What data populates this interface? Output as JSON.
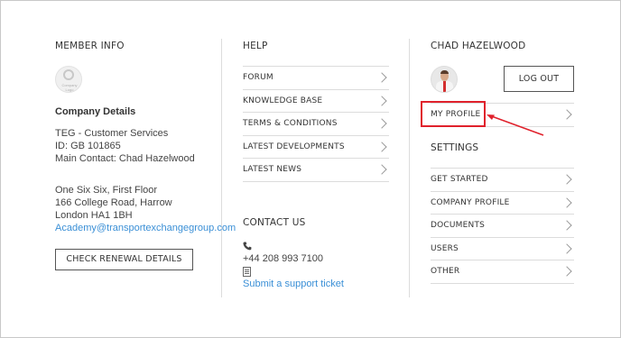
{
  "member_info": {
    "heading": "MEMBER INFO",
    "logo_caption": "Company Logo",
    "company_details_label": "Company Details",
    "company_lines": [
      "TEG - Customer Services",
      "ID: GB 101865",
      "Main Contact: Chad Hazelwood"
    ],
    "address_lines": [
      "One Six Six, First Floor",
      "166 College Road, Harrow",
      "London HA1 1BH"
    ],
    "email": "Academy@transportexchangegroup.com",
    "renewal_button": "CHECK RENEWAL DETAILS"
  },
  "help": {
    "heading": "HELP",
    "items": [
      {
        "label": "FORUM"
      },
      {
        "label": "KNOWLEDGE BASE"
      },
      {
        "label": "TERMS & CONDITIONS"
      },
      {
        "label": "LATEST DEVELOPMENTS"
      },
      {
        "label": "LATEST NEWS"
      }
    ]
  },
  "contact": {
    "heading": "CONTACT US",
    "phone": "+44 208 993 7100",
    "support_link": "Submit a support ticket"
  },
  "user": {
    "name_heading": "CHAD HAZELWOOD",
    "logout_button": "LOG OUT",
    "profile_item": "MY PROFILE"
  },
  "settings": {
    "heading": "SETTINGS",
    "items": [
      {
        "label": "GET STARTED"
      },
      {
        "label": "COMPANY PROFILE"
      },
      {
        "label": "DOCUMENTS"
      },
      {
        "label": "USERS"
      },
      {
        "label": "OTHER"
      }
    ]
  },
  "colors": {
    "link": "#3a8fd6",
    "highlight": "#e0212c",
    "divider": "#dcdcdc"
  }
}
